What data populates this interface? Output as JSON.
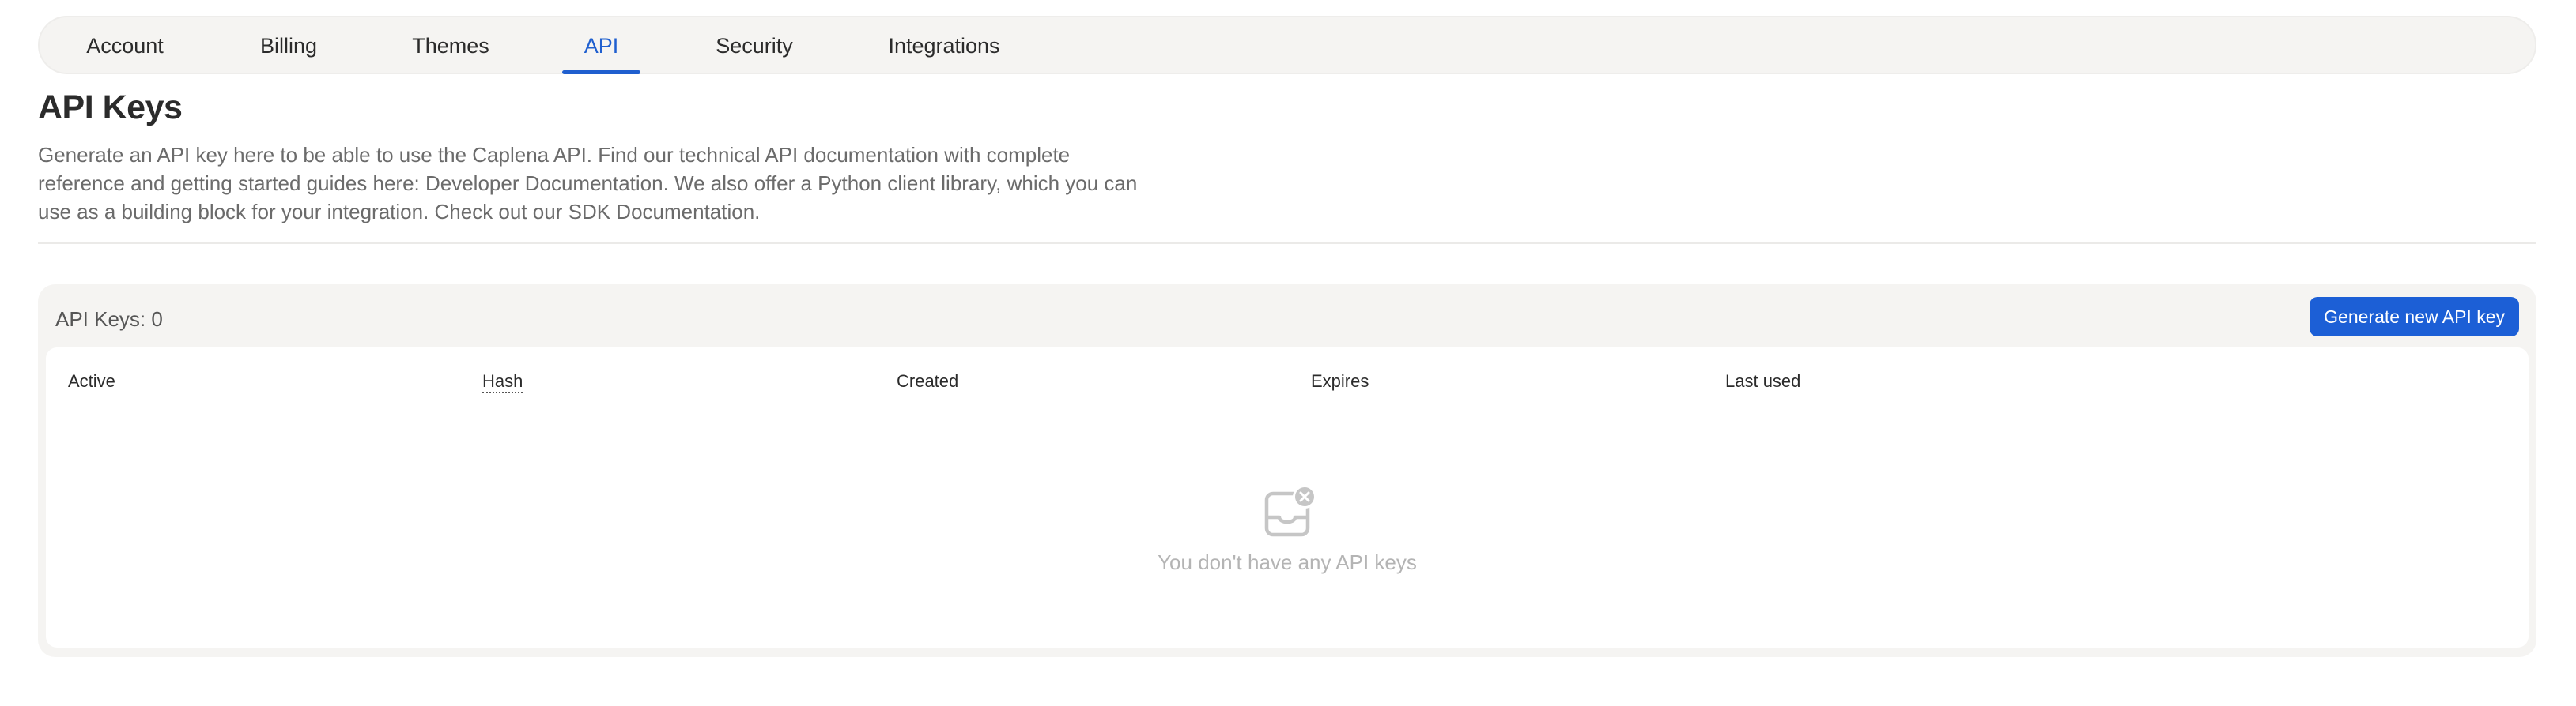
{
  "tabs": [
    {
      "label": "Account",
      "active": false
    },
    {
      "label": "Billing",
      "active": false
    },
    {
      "label": "Themes",
      "active": false
    },
    {
      "label": "API",
      "active": true
    },
    {
      "label": "Security",
      "active": false
    },
    {
      "label": "Integrations",
      "active": false
    }
  ],
  "page": {
    "title": "API Keys",
    "description": "Generate an API key here to be able to use the Caplena API. Find our technical API documentation with complete reference and getting started guides here: Developer Documentation. We also offer a Python client library, which you can use as a building block for your integration. Check out our SDK Documentation."
  },
  "keys_panel": {
    "count_label": "API Keys: 0",
    "generate_button": "Generate new API key",
    "columns": [
      "Active",
      "Hash",
      "Created",
      "Expires",
      "Last used"
    ],
    "empty_message": "You don't have any API keys",
    "empty_icon": "inbox-x-icon"
  },
  "colors": {
    "accent": "#1c5fd6",
    "active_tab": "#1f5fcf",
    "panel_background": "#f5f4f2",
    "muted_text": "#b4b4b4"
  }
}
